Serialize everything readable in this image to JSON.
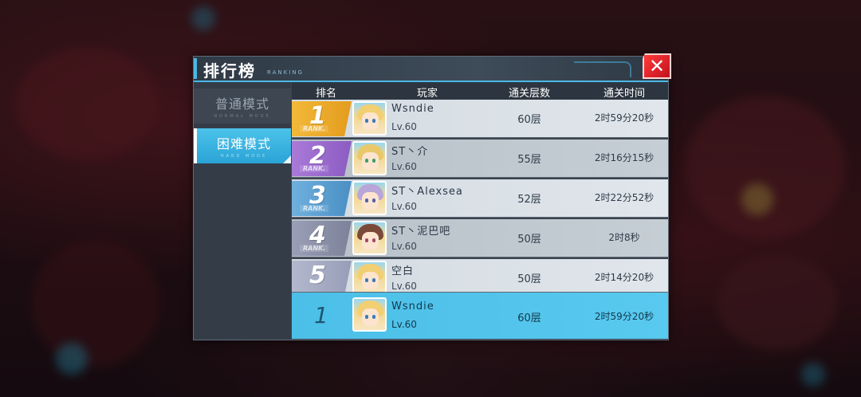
{
  "panel": {
    "title": "排行榜",
    "subtitle": "RANKING",
    "close_icon": "close-x-icon"
  },
  "tabs": [
    {
      "label": "普通模式",
      "sub": "NORMAL MODE",
      "active": false
    },
    {
      "label": "困难模式",
      "sub": "HARD MODE",
      "active": true
    }
  ],
  "table": {
    "headers": {
      "rank": "排名",
      "player": "玩家",
      "floors": "通关层数",
      "time": "通关时间"
    },
    "rank_tag": "RANK.",
    "rows": [
      {
        "rank": "1",
        "name": "Wsndie",
        "level": "Lv.60",
        "floors": "60层",
        "time": "2时59分20秒",
        "badge_color": "#e9a629"
      },
      {
        "rank": "2",
        "name": "ST丶介",
        "level": "Lv.60",
        "floors": "55层",
        "time": "2时16分15秒",
        "badge_color": "#9b6cc9"
      },
      {
        "rank": "3",
        "name": "ST丶Alexsea",
        "level": "Lv.60",
        "floors": "52层",
        "time": "2时22分52秒",
        "badge_color": "#5a9fd0"
      },
      {
        "rank": "4",
        "name": "ST丶泥巴吧",
        "level": "Lv.60",
        "floors": "50层",
        "time": "2时8秒",
        "badge_color": "#8a8fa6"
      },
      {
        "rank": "5",
        "name": "空白",
        "level": "Lv.60",
        "floors": "50层",
        "time": "2时14分20秒",
        "badge_color": "#a3a9c1"
      }
    ],
    "self_row": {
      "rank": "1",
      "name": "Wsndie",
      "level": "Lv.60",
      "floors": "60层",
      "time": "2时59分20秒"
    }
  },
  "colors": {
    "accent": "#4bb8e6",
    "close": "#e02a2a",
    "self_row": "#4cbfe8"
  }
}
